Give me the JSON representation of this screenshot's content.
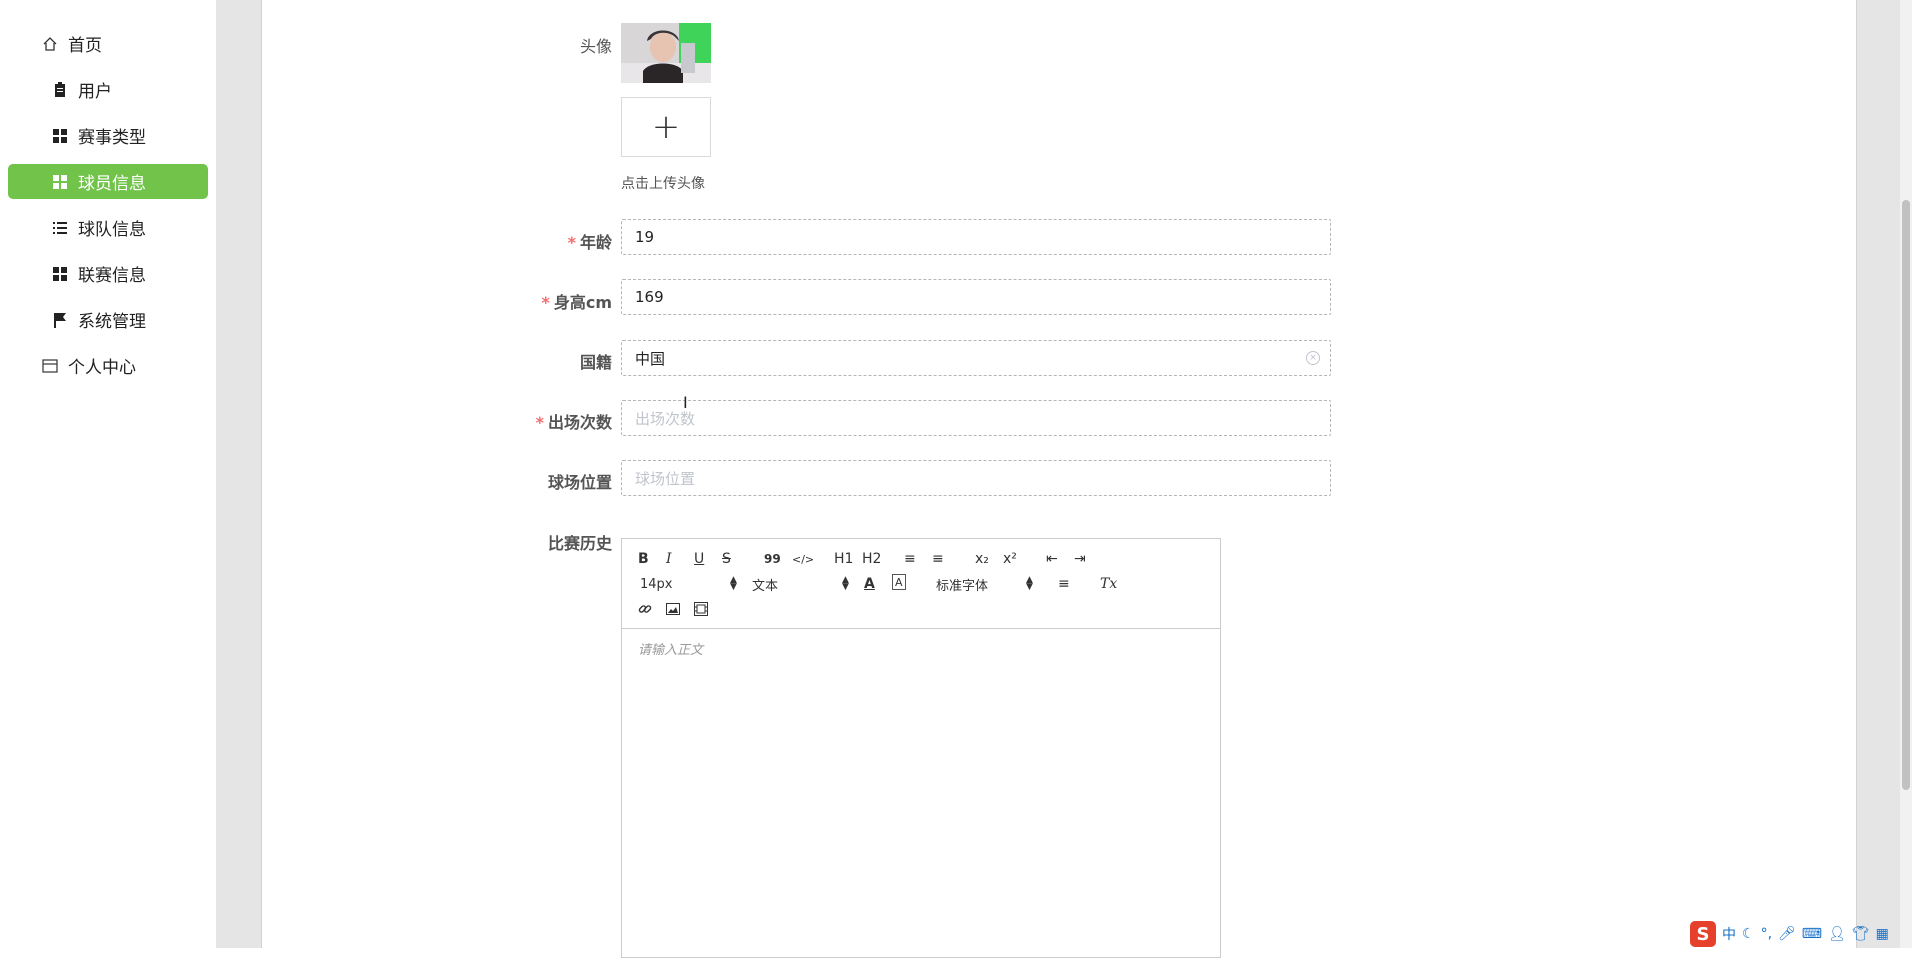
{
  "sidebar": {
    "items": [
      {
        "label": "首页",
        "icon": "home-icon",
        "type": "top"
      },
      {
        "label": "用户",
        "icon": "clipboard-icon",
        "type": "sub"
      },
      {
        "label": "赛事类型",
        "icon": "grid-icon",
        "type": "sub"
      },
      {
        "label": "球员信息",
        "icon": "grid-icon",
        "type": "sub",
        "active": true
      },
      {
        "label": "球队信息",
        "icon": "list-icon",
        "type": "sub"
      },
      {
        "label": "联赛信息",
        "icon": "grid-icon",
        "type": "sub"
      },
      {
        "label": "系统管理",
        "icon": "flag-icon",
        "type": "sub"
      },
      {
        "label": "个人中心",
        "icon": "card-icon",
        "type": "top"
      }
    ]
  },
  "form": {
    "avatar": {
      "label": "头像",
      "upload_hint": "点击上传头像",
      "upload_plus": "+"
    },
    "age": {
      "label": "年龄",
      "value": "19",
      "required": true
    },
    "height": {
      "label": "身高cm",
      "value": "169",
      "required": true
    },
    "nationality": {
      "label": "国籍",
      "value": "中国"
    },
    "appearances": {
      "label": "出场次数",
      "placeholder": "出场次数",
      "required": true
    },
    "position": {
      "label": "球场位置",
      "placeholder": "球场位置"
    },
    "history": {
      "label": "比赛历史"
    },
    "required_mark": "*"
  },
  "editor": {
    "toolbar": {
      "bold": "B",
      "italic": "I",
      "underline": "U",
      "strike": "S",
      "quote": "99",
      "code": "</>",
      "h1": "H1",
      "h2": "H2",
      "ordered_list": "≡",
      "bullet_list": "≡",
      "sub": "x₂",
      "sup": "x²",
      "outdent": "⇤",
      "indent": "⇥",
      "font_size": "14px",
      "header": "文本",
      "color": "A",
      "background": "A",
      "font_family": "标准字体",
      "align": "≡",
      "clean": "Tx"
    },
    "placeholder": "请输入正文"
  },
  "ime": {
    "logo": "S",
    "mode": "中"
  },
  "colors": {
    "accent": "#71c34a",
    "required": "#f56c6c"
  }
}
